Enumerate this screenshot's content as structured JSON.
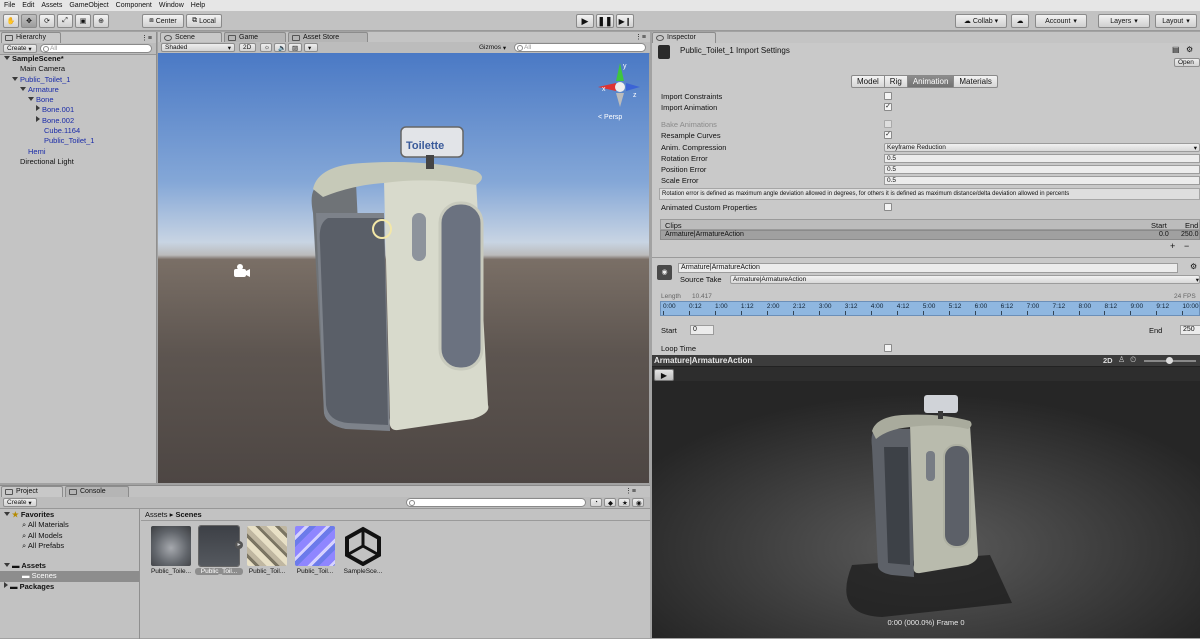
{
  "menu": [
    "File",
    "Edit",
    "Assets",
    "GameObject",
    "Component",
    "Window",
    "Help"
  ],
  "toolbar": {
    "pivot_center": "Center",
    "pivot_local": "Local",
    "collab": "Collab",
    "account": "Account",
    "layers": "Layers",
    "layout": "Layout"
  },
  "hierarchy": {
    "tab": "Hierarchy",
    "create": "Create",
    "search_placeholder": "All",
    "items": [
      {
        "label": "SampleScene*",
        "depth": 0,
        "arrow": "down",
        "blue": false,
        "bold": true
      },
      {
        "label": "Main Camera",
        "depth": 1,
        "arrow": "none",
        "blue": false
      },
      {
        "label": "Public_Toilet_1",
        "depth": 1,
        "arrow": "down",
        "blue": true
      },
      {
        "label": "Armature",
        "depth": 2,
        "arrow": "down",
        "blue": true
      },
      {
        "label": "Bone",
        "depth": 3,
        "arrow": "down",
        "blue": true
      },
      {
        "label": "Bone.001",
        "depth": 4,
        "arrow": "right",
        "blue": true
      },
      {
        "label": "Bone.002",
        "depth": 4,
        "arrow": "right",
        "blue": true
      },
      {
        "label": "Cube.1164",
        "depth": 4,
        "arrow": "none",
        "blue": true
      },
      {
        "label": "Public_Toilet_1",
        "depth": 4,
        "arrow": "none",
        "blue": true
      },
      {
        "label": "Hemi",
        "depth": 2,
        "arrow": "none",
        "blue": true
      },
      {
        "label": "Directional Light",
        "depth": 1,
        "arrow": "none",
        "blue": false
      }
    ]
  },
  "scene": {
    "tab_scene": "Scene",
    "tab_game": "Game",
    "tab_asset_store": "Asset Store",
    "shaded": "Shaded",
    "mode_2d": "2D",
    "gizmos": "Gizmos",
    "search_placeholder": "All",
    "persp": "< Persp",
    "sign_text": "Toilette"
  },
  "project": {
    "tab_project": "Project",
    "tab_console": "Console",
    "create": "Create",
    "favorites": "Favorites",
    "favorites_items": [
      "All Materials",
      "All Models",
      "All Prefabs"
    ],
    "assets": "Assets",
    "scenes": "Scenes",
    "packages": "Packages",
    "breadcrumb_root": "Assets",
    "breadcrumb_current": "Scenes",
    "thumb_labels": [
      "Public_Toile...",
      "Public_Toil...",
      "Public_Toil...",
      "Public_Toil...",
      "SampleSce..."
    ]
  },
  "inspector": {
    "tab": "Inspector",
    "title": "Public_Toilet_1 Import Settings",
    "open": "Open",
    "tabs": [
      "Model",
      "Rig",
      "Animation",
      "Materials"
    ],
    "active_tab": "Animation",
    "import_constraints": "Import Constraints",
    "import_animation": "Import Animation",
    "bake_animations": "Bake Animations",
    "resample_curves": "Resample Curves",
    "anim_compression": "Anim. Compression",
    "anim_compression_value": "Keyframe Reduction",
    "rotation_error": "Rotation Error",
    "rotation_error_value": "0.5",
    "position_error": "Position Error",
    "position_error_value": "0.5",
    "scale_error": "Scale Error",
    "scale_error_value": "0.5",
    "help_text": "Rotation error is defined as maximum angle deviation allowed in degrees, for others it is defined as maximum distance/delta deviation allowed in percents",
    "animated_custom_properties": "Animated Custom Properties",
    "clips_header": "Clips",
    "start_header": "Start",
    "end_header": "End",
    "clip_name": "Armature|ArmatureAction",
    "clip_start": "0.0",
    "clip_end": "250.0",
    "plus": "+",
    "minus": "−",
    "clip_name_field": "Armature|ArmatureAction",
    "source_take": "Source Take",
    "source_take_value": "Armature|ArmatureAction",
    "length": "Length",
    "length_value": "10.417",
    "fps": "24 FPS",
    "timeline_ticks": [
      "0:00",
      "0:12",
      "1:00",
      "1:12",
      "2:00",
      "2:12",
      "3:00",
      "3:12",
      "4:00",
      "4:12",
      "5:00",
      "5:12",
      "6:00",
      "6:12",
      "7:00",
      "7:12",
      "8:00",
      "8:12",
      "9:00",
      "9:12",
      "10:00"
    ],
    "start": "Start",
    "start_value": "0",
    "end": "End",
    "end_value": "250",
    "loop_time": "Loop Time"
  },
  "preview": {
    "title": "Armature|ArmatureAction",
    "mode_2d": "2D",
    "status": "0:00 (000.0%) Frame 0"
  }
}
